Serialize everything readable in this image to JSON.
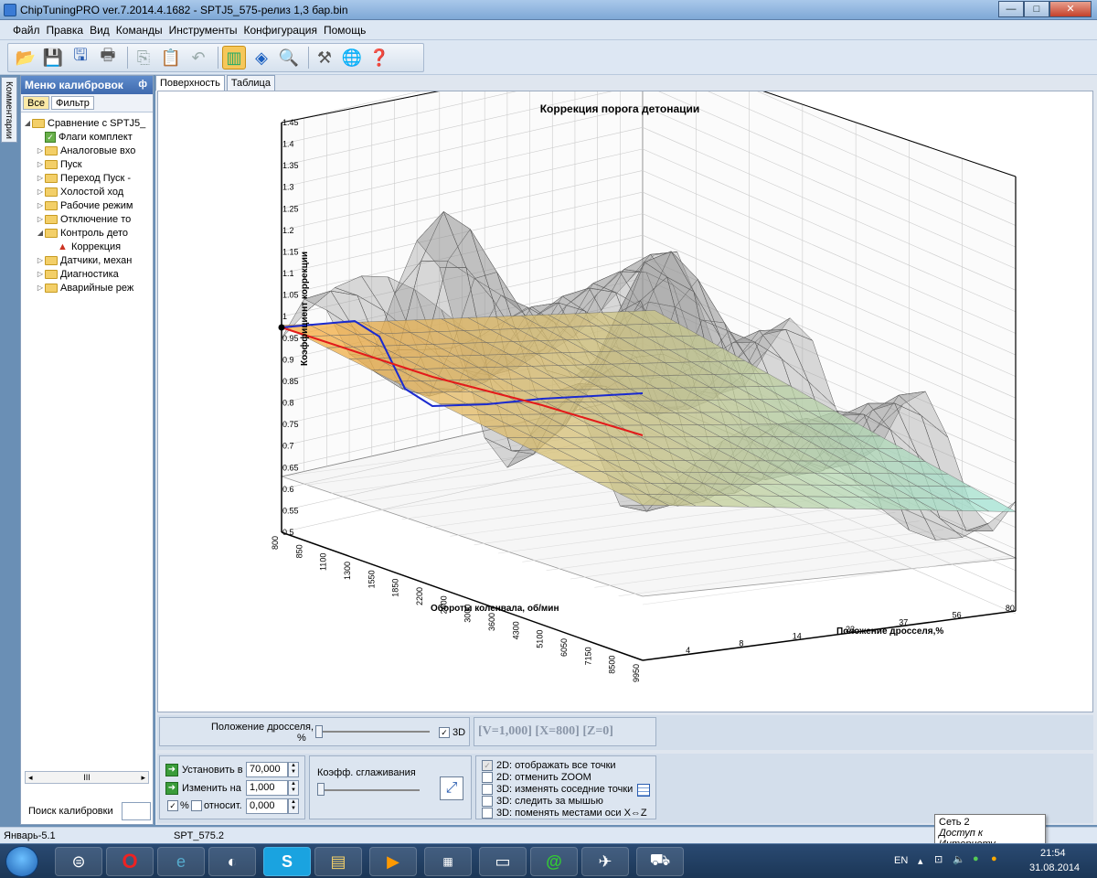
{
  "window": {
    "title": "ChipTuningPRO ver.7.2014.4.1682 - SPTJ5_575-релиз 1,3 бар.bin",
    "min": "—",
    "max": "□",
    "close": "✕"
  },
  "menu": [
    "Файл",
    "Правка",
    "Вид",
    "Команды",
    "Инструменты",
    "Конфигурация",
    "Помощь"
  ],
  "toolbar": {
    "icons": [
      "open-icon",
      "save-icon",
      "save-as-icon",
      "print-icon",
      "copy-icon",
      "paste-icon",
      "undo-icon",
      "compare-icon",
      "diamond-icon",
      "zoom-icon",
      "tools-icon",
      "network-icon",
      "help-icon"
    ]
  },
  "side_tab": "Комментарии",
  "calibration": {
    "header": "Меню калибровок",
    "pin": "ф",
    "tab_all": "Все",
    "tab_filter": "Фильтр",
    "tree": [
      {
        "label": "Сравнение с SPTJ5_",
        "level": 0,
        "arrow": "◢",
        "icon": "folder"
      },
      {
        "label": "Флаги комплект",
        "level": 1,
        "arrow": "",
        "icon": "check"
      },
      {
        "label": "Аналоговые вхо",
        "level": 1,
        "arrow": "▷",
        "icon": "folder"
      },
      {
        "label": "Пуск",
        "level": 1,
        "arrow": "▷",
        "icon": "folder"
      },
      {
        "label": "Переход Пуск -",
        "level": 1,
        "arrow": "▷",
        "icon": "folder"
      },
      {
        "label": "Холостой ход",
        "level": 1,
        "arrow": "▷",
        "icon": "folder"
      },
      {
        "label": "Рабочие режим",
        "level": 1,
        "arrow": "▷",
        "icon": "folder"
      },
      {
        "label": "Отключение то",
        "level": 1,
        "arrow": "▷",
        "icon": "folder"
      },
      {
        "label": "Контроль дето",
        "level": 1,
        "arrow": "◢",
        "icon": "folder"
      },
      {
        "label": "Коррекция",
        "level": 2,
        "arrow": "",
        "icon": "chart"
      },
      {
        "label": "Датчики, механ",
        "level": 1,
        "arrow": "▷",
        "icon": "folder"
      },
      {
        "label": "Диагностика",
        "level": 1,
        "arrow": "▷",
        "icon": "folder"
      },
      {
        "label": "Аварийные реж",
        "level": 1,
        "arrow": "▷",
        "icon": "folder"
      }
    ],
    "scroll_left": "◂",
    "scroll_mid": "III",
    "scroll_right": "▸",
    "search_label": "Поиск калибровки"
  },
  "tabs": {
    "surface": "Поверхность",
    "table": "Таблица"
  },
  "chart_data": {
    "type": "surface3d",
    "title": "Коррекция порога детонации",
    "zlabel": "Коэффициент коррекции",
    "xlabel": "Обороты коленвала, об/мин",
    "ylabel": "Положение дросселя,%",
    "z_ticks": [
      "1.45",
      "1.4",
      "1.35",
      "1.3",
      "1.25",
      "1.2",
      "1.15",
      "1.1",
      "1.05",
      "1",
      "0.95",
      "0.9",
      "0.85",
      "0.8",
      "0.75",
      "0.7",
      "0.65",
      "0.6",
      "0.55",
      "0.5"
    ],
    "z_range": [
      0.5,
      1.45
    ],
    "x_ticks": [
      "800",
      "850",
      "1100",
      "1300",
      "1550",
      "1850",
      "2200",
      "2600",
      "3000",
      "3600",
      "4300",
      "5100",
      "6050",
      "7150",
      "8500",
      "9950"
    ],
    "y_ticks": [
      "4",
      "8",
      "14",
      "23",
      "37",
      "56",
      "80"
    ],
    "marker_value": "1"
  },
  "controls": {
    "throttle_label": "Положение дросселя,",
    "throttle_unit": "%",
    "mode_3d": "3D",
    "readout": "[V=1,000] [X=800] [Z=0]",
    "set_label": "Установить в",
    "set_value": "70,000",
    "change_label": "Изменить на",
    "change_value": "1,000",
    "percent_label": "%",
    "relative_label": "относит.",
    "relative_value": "0,000",
    "smooth_label": "Коэфф. сглаживания",
    "opt_all_points": "2D: отображать все точки",
    "opt_cancel_zoom": "2D: отменить ZOOM",
    "opt_neighbors": "3D: изменять соседние точки",
    "opt_follow_mouse": "3D: следить за мышью",
    "opt_swap_axes": "3D: поменять местами оси X⇔Z"
  },
  "status": {
    "left": "Январь-5.1",
    "right": "SPT_575.2"
  },
  "tooltip": {
    "line1": "Сеть 2",
    "line2": "Доступ к Интернету"
  },
  "tray": {
    "lang": "EN",
    "time": "21:54",
    "date": "31.08.2014"
  },
  "taskbar": [
    "start-button",
    "arrows-app",
    "opera-app",
    "ie-app",
    "browser-app",
    "skype-app",
    "explorer-app",
    "player-app",
    "calendar-app",
    "monitor-app",
    "mail-app",
    "plane-app",
    "car-app"
  ]
}
